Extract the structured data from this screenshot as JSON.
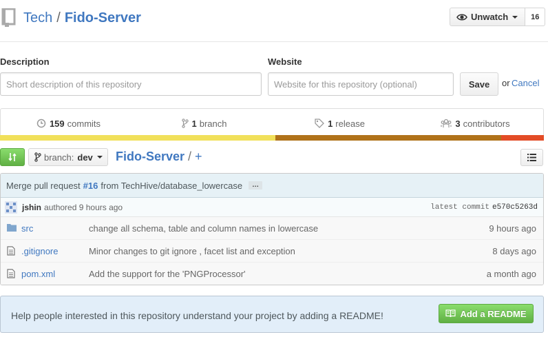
{
  "header": {
    "owner": "Tech",
    "separator": "/",
    "repo_name": "Fido-Server",
    "watch_label": "Unwatch",
    "watch_count": "16"
  },
  "edit_form": {
    "description_label": "Description",
    "description_placeholder": "Short description of this repository",
    "website_label": "Website",
    "website_placeholder": "Website for this repository (optional)",
    "save_label": "Save",
    "or_text": "or",
    "cancel_label": "Cancel"
  },
  "stats": {
    "commits": {
      "count": "159",
      "label": "commits",
      "icon": "history-icon"
    },
    "branches": {
      "count": "1",
      "label": "branch",
      "icon": "branch-icon"
    },
    "releases": {
      "count": "1",
      "label": "release",
      "icon": "tag-icon"
    },
    "contributors": {
      "count": "3",
      "label": "contributors",
      "icon": "organization-icon"
    }
  },
  "language_bar": [
    {
      "color": "#f1e05a",
      "fraction": 0.506
    },
    {
      "color": "#b07219",
      "fraction": 0.415
    },
    {
      "color": "#e34c26",
      "fraction": 0.079
    }
  ],
  "file_nav": {
    "branch_prefix": "branch:",
    "branch_name": "dev",
    "root_path": "Fido-Server",
    "path_sep": "/",
    "plus": "+"
  },
  "commit": {
    "title_prefix": "Merge pull request",
    "pr_number": "#16",
    "title_suffix": "from TechHive/database_lowercase",
    "ellipsis": "…",
    "author": "jshin",
    "authored": "authored 9 hours ago",
    "latest_label": "latest commit",
    "sha": "e570c5263d"
  },
  "files": [
    {
      "icon": "folder-icon",
      "name": "src",
      "message": "change all schema, table and column names in lowercase",
      "age": "9 hours ago"
    },
    {
      "icon": "file-text-icon",
      "name": ".gitignore",
      "message": "Minor changes to git ignore , facet list and exception",
      "age": "8 days ago"
    },
    {
      "icon": "file-text-icon",
      "name": "pom.xml",
      "message": "Add the support for the 'PNGProcessor'",
      "age": "a month ago"
    }
  ],
  "readme": {
    "message": "Help people interested in this repository understand your project by adding a README!",
    "button_label": "Add a README"
  }
}
